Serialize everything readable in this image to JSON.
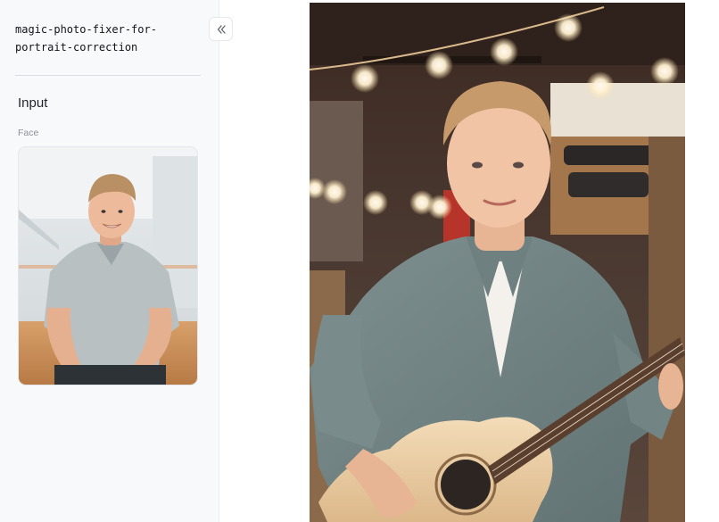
{
  "app": {
    "title": "magic-photo-fixer-for-portrait-correction"
  },
  "sidebar": {
    "collapse_icon": "double-chevron-left-icon",
    "section_heading": "Input",
    "face_field": {
      "label": "Face"
    }
  },
  "main": {
    "output_image": "portrait-with-guitar"
  },
  "colors": {
    "sidebar_bg": "#f8f9fb",
    "divider": "#d9dde3",
    "title_text": "#111418",
    "muted_text": "#8b9099"
  }
}
